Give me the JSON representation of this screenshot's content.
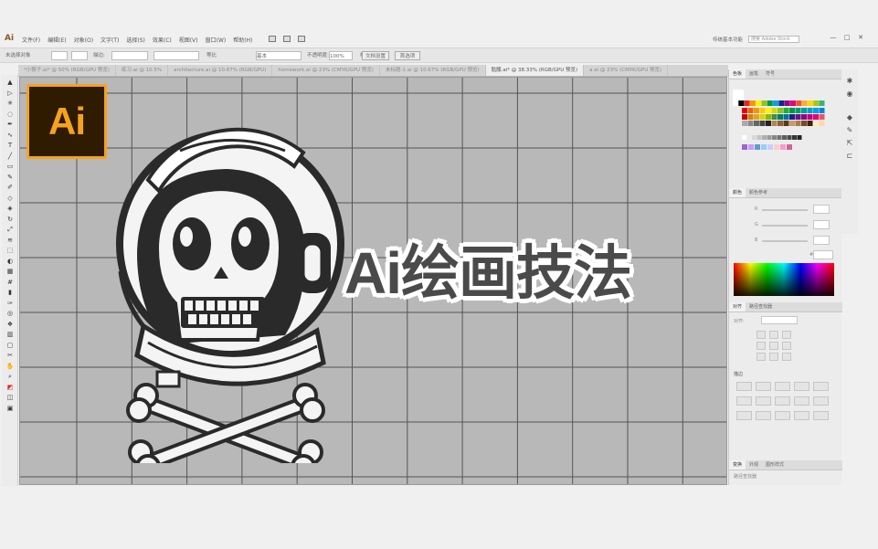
{
  "app": {
    "logo_text": "Ai"
  },
  "menus": [
    "文件(F)",
    "编辑(E)",
    "对象(O)",
    "文字(T)",
    "选择(S)",
    "效果(C)",
    "视图(V)",
    "窗口(W)",
    "帮助(H)"
  ],
  "menubar_right": {
    "workspace": "传统基本功能",
    "search_placeholder": "搜索 Adobe Stock",
    "win_min": "—",
    "win_max": "□",
    "win_close": "✕"
  },
  "controlbar": {
    "selection": "未选择对象",
    "stroke_label": "描边:",
    "uniform": "等比",
    "basic": "基本",
    "opacity": "不透明度:",
    "opacity_value": "100%",
    "style": "样式:",
    "doc_settings": "文档设置",
    "preferences": "首选项"
  },
  "tabs": [
    {
      "label": "*小猴子.ai* @ 50% (RGB/GPU 预览)",
      "active": false
    },
    {
      "label": "练习.ai @ 10.5%",
      "active": false
    },
    {
      "label": "architecture.ai @ 10.67% (RGB/GPU)",
      "active": false
    },
    {
      "label": "homework.ai @ 23% (CMYK/GPU 预览)",
      "active": false
    },
    {
      "label": "未标题-1.ai @ 10.67% (RGB/GPU 预览)",
      "active": false
    },
    {
      "label": "骷髅.ai* @ 38.33% (RGB/GPU 预览)",
      "active": true
    },
    {
      "label": "a.ai @ 23% (CMYK/GPU 预览)",
      "active": false
    }
  ],
  "tools": [
    "select-tool",
    "direct-select-tool",
    "magic-wand-tool",
    "lasso-tool",
    "pen-tool",
    "curvature-tool",
    "type-tool",
    "line-tool",
    "rectangle-tool",
    "paintbrush-tool",
    "pencil-tool",
    "shaper-tool",
    "eraser-tool",
    "rotate-tool",
    "scale-tool",
    "width-tool",
    "free-transform-tool",
    "shape-builder-tool",
    "perspective-grid-tool",
    "mesh-tool",
    "gradient-tool",
    "eyedropper-tool",
    "blend-tool",
    "symbol-sprayer-tool",
    "column-graph-tool",
    "artboard-tool",
    "slice-tool",
    "hand-tool",
    "zoom-tool",
    "fill-stroke",
    "draw-mode",
    "screen-mode"
  ],
  "canvas": {
    "logo_text": "Ai",
    "headline": "Ai绘画技法",
    "background": "#b8b8b8",
    "grid_color": "#555555"
  },
  "panels": {
    "swatches_tabs": [
      "色板",
      "画笔",
      "符号"
    ],
    "color_tabs": [
      "颜色",
      "颜色参考"
    ],
    "color_rows": [
      "R",
      "G",
      "B"
    ],
    "color_hex_label": "#",
    "align_tabs": [
      "对齐",
      "路径查找器"
    ],
    "align_label": "对齐:",
    "stroke_label": "描边",
    "bottom_tabs": [
      "变换",
      "外观",
      "图形样式"
    ],
    "bottom_label": "路径查找器"
  }
}
